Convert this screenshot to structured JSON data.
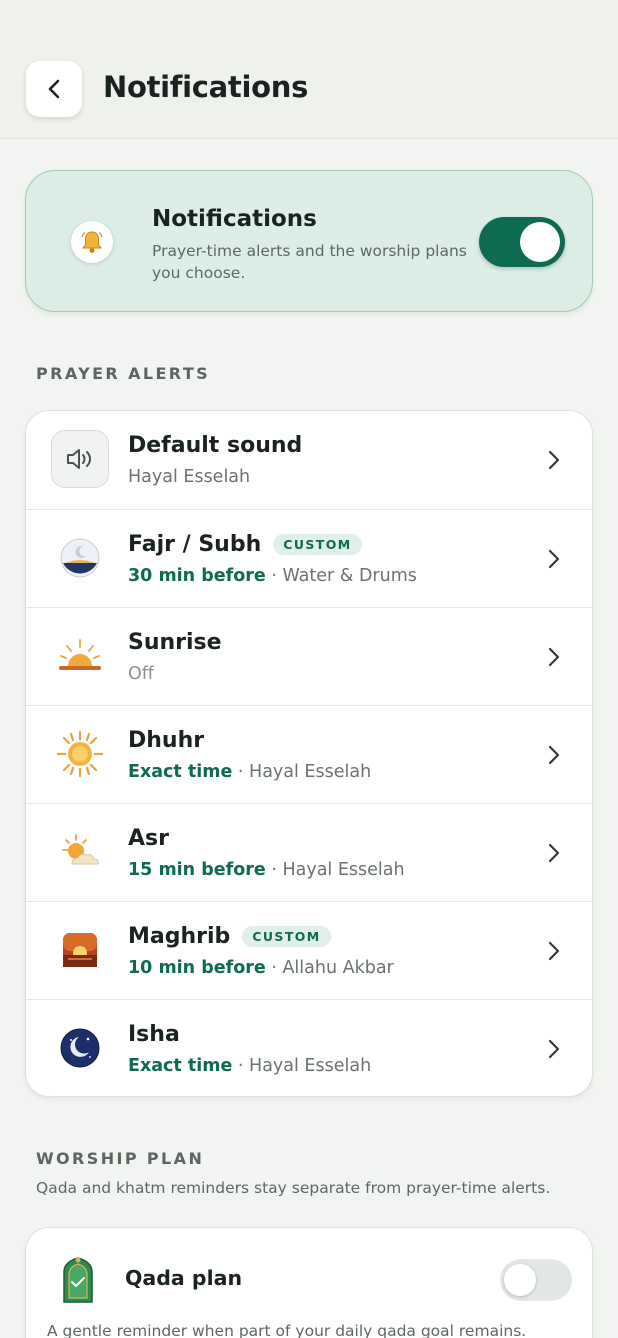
{
  "header": {
    "title": "Notifications",
    "back_icon": "chevron-left-icon"
  },
  "master": {
    "title": "Notifications",
    "description": "Prayer-time alerts and the worship plans you choose.",
    "enabled": true,
    "icon": "bell-icon"
  },
  "sections": {
    "prayer_alerts": "PRAYER ALERTS",
    "worship_plan": "WORSHIP PLAN",
    "worship_plan_sub": "Qada and khatm reminders stay separate from prayer-time alerts."
  },
  "rows": [
    {
      "title": "Default sound",
      "badge": "",
      "timing": "",
      "detail": "Hayal Esselah",
      "icon": "speaker-icon"
    },
    {
      "title": "Fajr / Subh",
      "badge": "CUSTOM",
      "timing": "30 min before",
      "detail": " · Water & Drums",
      "icon": "crescent-dawn-icon"
    },
    {
      "title": "Sunrise",
      "badge": "",
      "timing": "",
      "detail": "Off",
      "icon": "sunrise-icon"
    },
    {
      "title": "Dhuhr",
      "badge": "",
      "timing": "Exact time",
      "detail": " · Hayal Esselah",
      "icon": "sun-icon"
    },
    {
      "title": "Asr",
      "badge": "",
      "timing": "15 min before",
      "detail": " · Hayal Esselah",
      "icon": "sun-cloud-icon"
    },
    {
      "title": "Maghrib",
      "badge": "CUSTOM",
      "timing": "10 min before",
      "detail": " · Allahu Akbar",
      "icon": "sunset-icon"
    },
    {
      "title": "Isha",
      "badge": "",
      "timing": "Exact time",
      "detail": " · Hayal Esselah",
      "icon": "moon-stars-icon"
    }
  ],
  "plan": {
    "title": "Qada plan",
    "enabled": false,
    "description": "A gentle reminder when part of your daily qada goal remains.",
    "icon": "prayer-mat-icon"
  },
  "colors": {
    "accent": "#0e6b52",
    "background": "#f2f4f1",
    "card_tint": "#ddeee7"
  }
}
